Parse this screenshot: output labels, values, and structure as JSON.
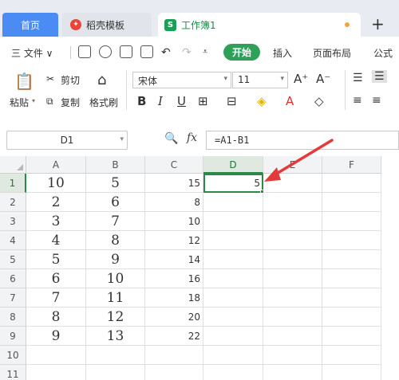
{
  "tabs": {
    "home": "首页",
    "template": "稻壳模板",
    "workbook": "工作簿1",
    "add": "+"
  },
  "menu": {
    "file": "三 文件 ∨",
    "start": "开始",
    "insert": "插入",
    "page_layout": "页面布局",
    "formula": "公式"
  },
  "toolbar": {
    "paste": "粘贴",
    "cut": "剪切",
    "copy": "复制",
    "format_painter": "格式刷",
    "font_name": "宋体",
    "font_size": "11",
    "bold": "B",
    "italic": "I",
    "underline": "U",
    "grow": "A⁺",
    "shrink": "A⁻"
  },
  "formula_bar": {
    "name_box": "D1",
    "fx": "fx",
    "formula": "=A1-B1"
  },
  "grid": {
    "columns": [
      "A",
      "B",
      "C",
      "D",
      "E",
      "F"
    ],
    "rows": [
      "1",
      "2",
      "3",
      "4",
      "5",
      "6",
      "7",
      "8",
      "9",
      "10",
      "11"
    ],
    "A": [
      "10",
      "2",
      "3",
      "4",
      "5",
      "6",
      "7",
      "8",
      "9",
      "",
      ""
    ],
    "B": [
      "5",
      "6",
      "7",
      "8",
      "9",
      "10",
      "11",
      "12",
      "13",
      "",
      ""
    ],
    "C": [
      "15",
      "8",
      "10",
      "12",
      "14",
      "16",
      "18",
      "20",
      "22",
      "",
      ""
    ],
    "D": [
      "5",
      "",
      "",
      "",
      "",
      "",
      "",
      "",
      "",
      "",
      ""
    ],
    "active_cell": "D1"
  },
  "colors": {
    "accent_green": "#2a8a4a",
    "home_tab_blue": "#4b8bf4",
    "arrow_red": "#e23b3b"
  }
}
